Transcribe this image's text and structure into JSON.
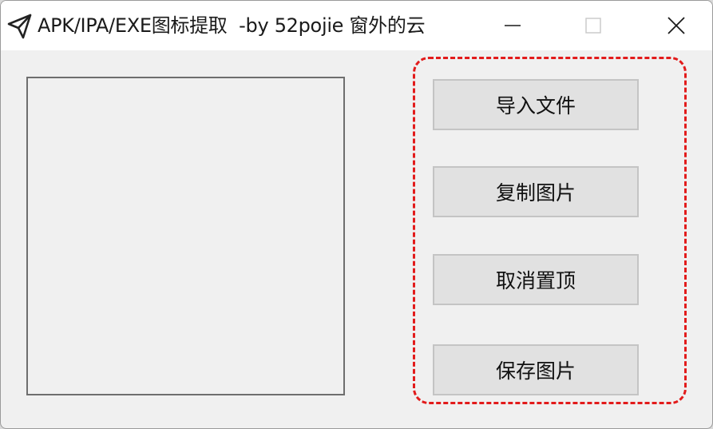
{
  "window": {
    "title": "APK/IPA/EXE图标提取  -by 52pojie 窗外的云",
    "app_icon": "send-icon",
    "controls": {
      "minimize_icon": "minimize-icon",
      "maximize_icon": "maximize-icon",
      "close_icon": "close-icon"
    }
  },
  "preview": {
    "content": ""
  },
  "actions": [
    {
      "label": "导入文件"
    },
    {
      "label": "复制图片"
    },
    {
      "label": "取消置顶"
    },
    {
      "label": "保存图片"
    }
  ],
  "colors": {
    "highlight": "#e21b1b",
    "window_bg": "#f0f0f0",
    "button_bg": "#e1e1e1"
  }
}
